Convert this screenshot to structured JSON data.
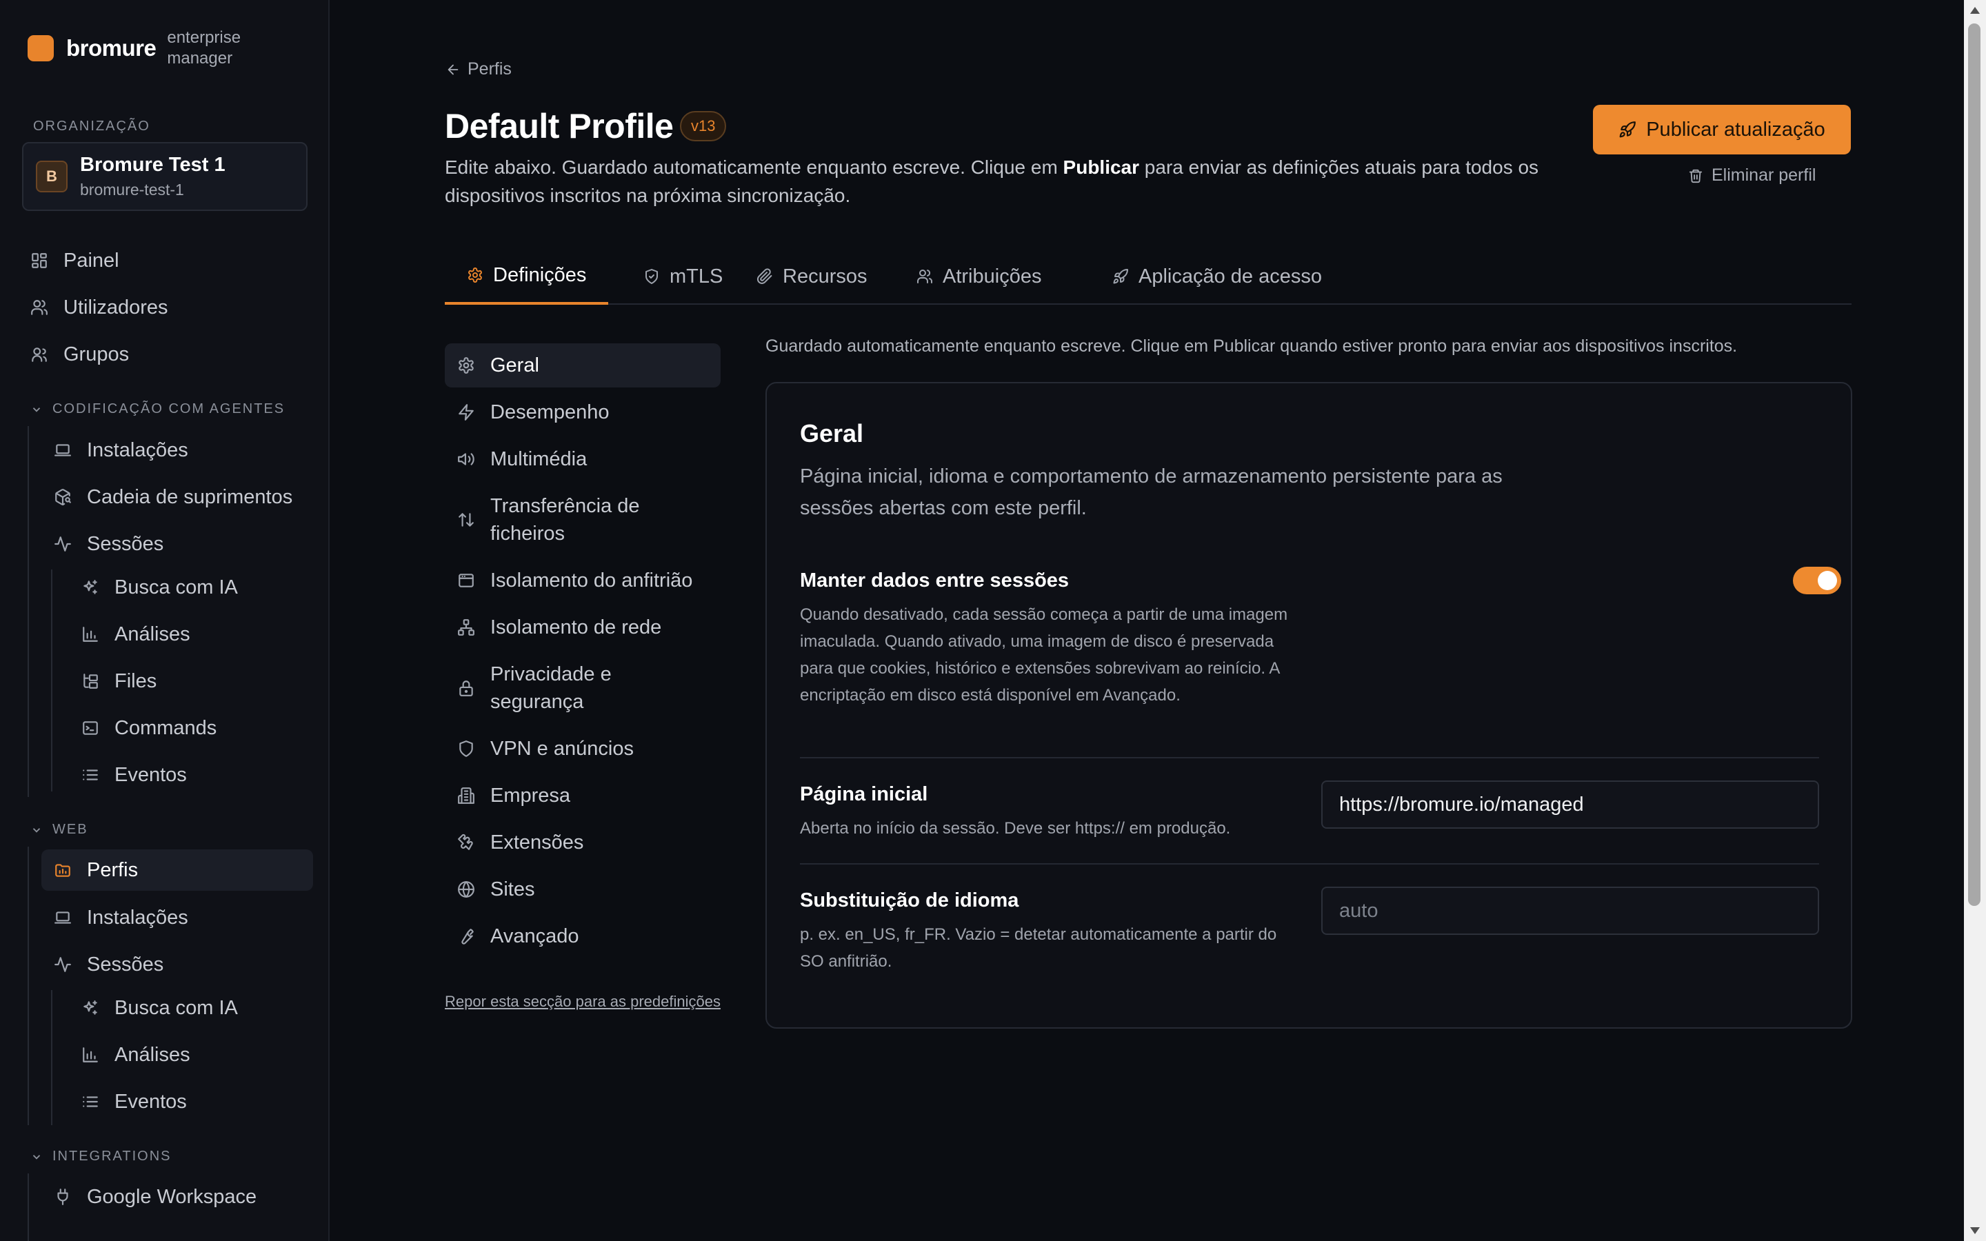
{
  "brand": {
    "name": "bromure",
    "subtitle": "enterprise manager"
  },
  "org": {
    "section_label": "ORGANIZAÇÃO",
    "avatar": "B",
    "name": "Bromure Test 1",
    "slug": "bromure-test-1"
  },
  "nav": {
    "top": [
      {
        "label": "Painel",
        "icon": "dashboard-icon"
      },
      {
        "label": "Utilizadores",
        "icon": "users-icon"
      },
      {
        "label": "Grupos",
        "icon": "group-icon"
      }
    ],
    "coding_group": "CODIFICAÇÃO COM AGENTES",
    "coding": [
      {
        "label": "Instalações",
        "icon": "laptop-icon"
      },
      {
        "label": "Cadeia de suprimentos",
        "icon": "package-search-icon"
      },
      {
        "label": "Sessões",
        "icon": "activity-icon"
      }
    ],
    "coding_sessions": [
      {
        "label": "Busca com IA",
        "icon": "sparkles-icon"
      },
      {
        "label": "Análises",
        "icon": "bar-chart-icon"
      },
      {
        "label": "Files",
        "icon": "folder-tree-icon"
      },
      {
        "label": "Commands",
        "icon": "terminal-icon"
      },
      {
        "label": "Eventos",
        "icon": "list-icon"
      }
    ],
    "web_group": "WEB",
    "web": [
      {
        "label": "Perfis",
        "icon": "folder-profile-icon"
      },
      {
        "label": "Instalações",
        "icon": "laptop-icon"
      },
      {
        "label": "Sessões",
        "icon": "activity-icon"
      }
    ],
    "web_sessions": [
      {
        "label": "Busca com IA",
        "icon": "sparkles-icon"
      },
      {
        "label": "Análises",
        "icon": "bar-chart-icon"
      },
      {
        "label": "Eventos",
        "icon": "list-icon"
      }
    ],
    "integrations_group": "INTEGRATIONS",
    "integrations": [
      {
        "label": "Google Workspace",
        "icon": "plug-icon"
      }
    ]
  },
  "header": {
    "back_label": "Perfis",
    "title": "Default Profile",
    "version": "v13",
    "desc_before": "Edite abaixo. Guardado automaticamente enquanto escreve. Clique em ",
    "desc_bold": "Publicar",
    "desc_after": " para enviar as definições atuais para todos os dispositivos inscritos na próxima sincronização.",
    "publish_label": "Publicar atualização",
    "delete_label": "Eliminar perfil"
  },
  "tabs": [
    {
      "label": "Definições",
      "icon": "gear-icon",
      "active": true
    },
    {
      "label": "mTLS",
      "icon": "shield-check-icon"
    },
    {
      "label": "Recursos",
      "icon": "paperclip-icon"
    },
    {
      "label": "Atribuições",
      "icon": "users-icon"
    },
    {
      "label": "Aplicação de acesso",
      "icon": "rocket-icon"
    }
  ],
  "subnav": [
    {
      "label": "Geral",
      "icon": "gear-icon",
      "active": true
    },
    {
      "label": "Desempenho",
      "icon": "zap-icon"
    },
    {
      "label": "Multimédia",
      "icon": "volume-icon"
    },
    {
      "label": "Transferência de ficheiros",
      "icon": "arrow-up-down-icon"
    },
    {
      "label": "Isolamento do anfitrião",
      "icon": "window-icon"
    },
    {
      "label": "Isolamento de rede",
      "icon": "network-icon"
    },
    {
      "label": "Privacidade e segurança",
      "icon": "lock-icon"
    },
    {
      "label": "VPN e anúncios",
      "icon": "shield-icon"
    },
    {
      "label": "Empresa",
      "icon": "building-icon"
    },
    {
      "label": "Extensões",
      "icon": "puzzle-icon"
    },
    {
      "label": "Sites",
      "icon": "globe-icon"
    },
    {
      "label": "Avançado",
      "icon": "wrench-icon"
    }
  ],
  "reset_label": "Repor esta secção para as predefinições",
  "content": {
    "autosave_note": "Guardado automaticamente enquanto escreve. Clique em Publicar quando estiver pronto para enviar aos dispositivos inscritos.",
    "title": "Geral",
    "desc": "Página inicial, idioma e comportamento de armazenamento persistente para as sessões abertas com este perfil.",
    "persist": {
      "title": "Manter dados entre sessões",
      "desc": "Quando desativado, cada sessão começa a partir de uma imagem imaculada. Quando ativado, uma imagem de disco é preservada para que cookies, histórico e extensões sobrevivam ao reinício. A encriptação em disco está disponível em Avançado.",
      "enabled": true
    },
    "homepage": {
      "title": "Página inicial",
      "desc": "Aberta no início da sessão. Deve ser https:// em produção.",
      "value": "https://bromure.io/managed"
    },
    "locale": {
      "title": "Substituição de idioma",
      "desc": "p. ex. en_US, fr_FR. Vazio = detetar automaticamente a partir do SO anfitrião.",
      "value": "",
      "placeholder": "auto"
    }
  },
  "colors": {
    "accent": "#ee8a2f",
    "background": "#0b0d12",
    "sidebar": "#0f1117"
  }
}
